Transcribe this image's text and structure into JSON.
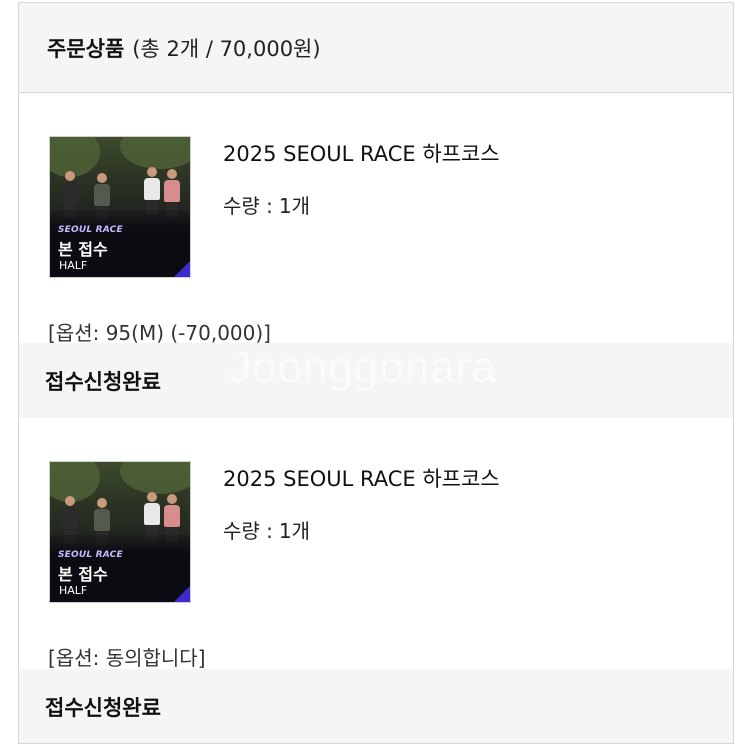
{
  "order": {
    "title": "주문상품",
    "summary": "(총 2개 / 70,000원)"
  },
  "items": [
    {
      "thumbnail": {
        "race_tag": "SEOUL RACE",
        "main_tag": "본 접수",
        "sub_tag": "HALF"
      },
      "name": "2025 SEOUL RACE 하프코스",
      "quantity_label": "수량 :",
      "quantity_value": "1개",
      "option": "[옵션: 95(M) (-70,000)]",
      "status": "접수신청완료"
    },
    {
      "thumbnail": {
        "race_tag": "SEOUL RACE",
        "main_tag": "본 접수",
        "sub_tag": "HALF"
      },
      "name": "2025 SEOUL RACE 하프코스",
      "quantity_label": "수량 :",
      "quantity_value": "1개",
      "option": "[옵션: 동의합니다]",
      "status": "접수신청완료"
    }
  ],
  "watermark": "Joonggonara",
  "colors": {
    "header_bg": "#f5f5f5",
    "border": "#d6d6d6",
    "thumbnail_accent": "#3b2ccf"
  }
}
